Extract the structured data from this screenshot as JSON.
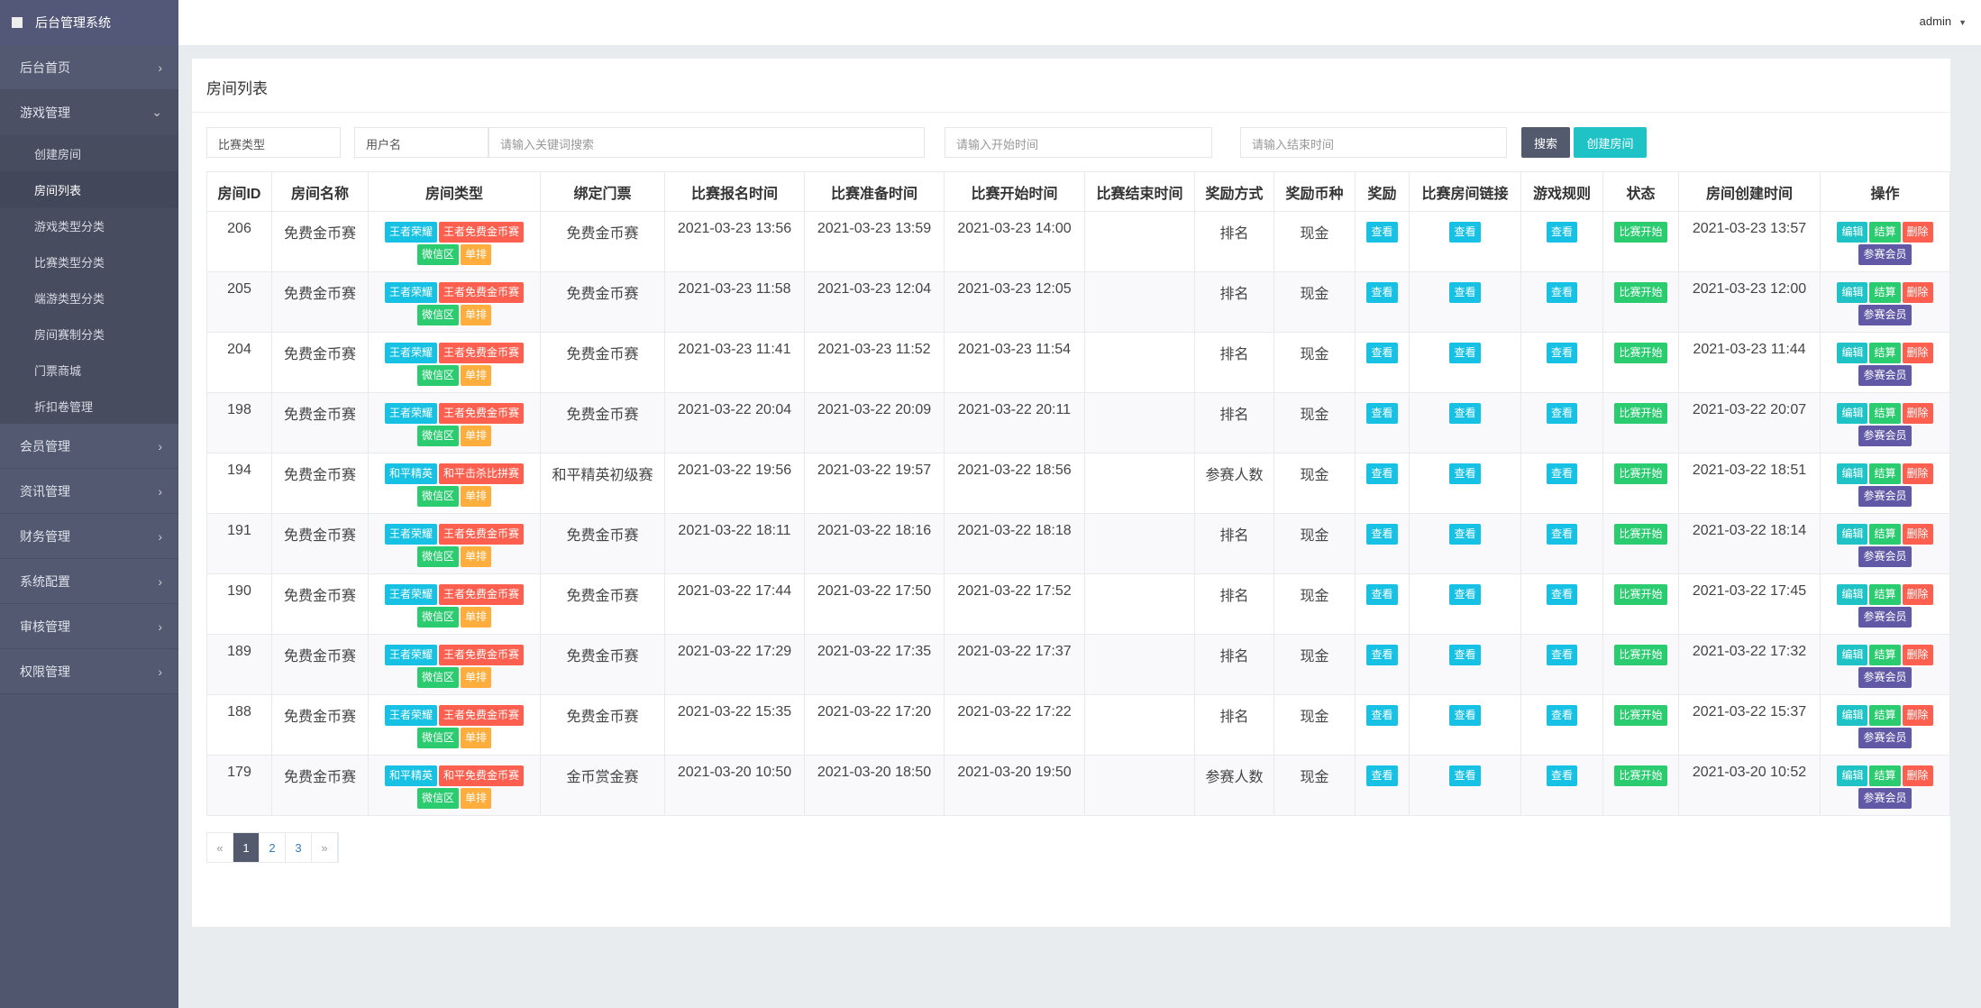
{
  "app_title": "后台管理系统",
  "user": {
    "name": "admin"
  },
  "sidebar": [
    {
      "label": "后台首页",
      "open": false
    },
    {
      "label": "游戏管理",
      "open": true,
      "children": [
        "创建房间",
        "房间列表",
        "游戏类型分类",
        "比赛类型分类",
        "端游类型分类",
        "房间赛制分类",
        "门票商城",
        "折扣卷管理"
      ],
      "active_child": 1
    },
    {
      "label": "会员管理"
    },
    {
      "label": "资讯管理"
    },
    {
      "label": "财务管理"
    },
    {
      "label": "系统配置"
    },
    {
      "label": "审核管理"
    },
    {
      "label": "权限管理"
    }
  ],
  "page_title": "房间列表",
  "filters": {
    "match_type": "比赛类型",
    "username": "用户名",
    "keyword_placeholder": "请输入关键词搜索",
    "start_placeholder": "请输入开始时间",
    "end_placeholder": "请输入结束时间",
    "search": "搜索",
    "create": "创建房间"
  },
  "colors": {
    "cyan": "#17c1e3",
    "red": "#ff5f4e",
    "green": "#2bcb70",
    "orange": "#ffad3c",
    "teal": "#1fc3c6",
    "purple": "#6159a6",
    "dark": "#535a6e"
  },
  "table": {
    "columns": [
      "房间ID",
      "房间名称",
      "房间类型",
      "绑定门票",
      "比赛报名时间",
      "比赛准备时间",
      "比赛开始时间",
      "比赛结束时间",
      "奖励方式",
      "奖励币种",
      "奖励",
      "比赛房间链接",
      "游戏规则",
      "状态",
      "房间创建时间",
      "操作"
    ],
    "view_label": "查看",
    "status_label": "比赛开始",
    "actions": [
      "编辑",
      "结算",
      "删除",
      "参赛会员"
    ],
    "rows": [
      {
        "id": "206",
        "name": "免费金币赛",
        "types": [
          "王者荣耀",
          "王者免费金币赛",
          "微信区",
          "单排"
        ],
        "ticket": "免费金币赛",
        "signup": "2021-03-23 13:56",
        "prepare": "2021-03-23 13:59",
        "start": "2021-03-23 14:00",
        "end": "",
        "reward_mode": "排名",
        "currency": "现金",
        "created": "2021-03-23 13:57"
      },
      {
        "id": "205",
        "name": "免费金币赛",
        "types": [
          "王者荣耀",
          "王者免费金币赛",
          "微信区",
          "单排"
        ],
        "ticket": "免费金币赛",
        "signup": "2021-03-23 11:58",
        "prepare": "2021-03-23 12:04",
        "start": "2021-03-23 12:05",
        "end": "",
        "reward_mode": "排名",
        "currency": "现金",
        "created": "2021-03-23 12:00"
      },
      {
        "id": "204",
        "name": "免费金币赛",
        "types": [
          "王者荣耀",
          "王者免费金币赛",
          "微信区",
          "单排"
        ],
        "ticket": "免费金币赛",
        "signup": "2021-03-23 11:41",
        "prepare": "2021-03-23 11:52",
        "start": "2021-03-23 11:54",
        "end": "",
        "reward_mode": "排名",
        "currency": "现金",
        "created": "2021-03-23 11:44"
      },
      {
        "id": "198",
        "name": "免费金币赛",
        "types": [
          "王者荣耀",
          "王者免费金币赛",
          "微信区",
          "单排"
        ],
        "ticket": "免费金币赛",
        "signup": "2021-03-22 20:04",
        "prepare": "2021-03-22 20:09",
        "start": "2021-03-22 20:11",
        "end": "",
        "reward_mode": "排名",
        "currency": "现金",
        "created": "2021-03-22 20:07"
      },
      {
        "id": "194",
        "name": "免费金币赛",
        "types": [
          "和平精英",
          "和平击杀比拼赛",
          "微信区",
          "单排"
        ],
        "ticket": "和平精英初级赛",
        "signup": "2021-03-22 19:56",
        "prepare": "2021-03-22 19:57",
        "start": "2021-03-22 18:56",
        "end": "",
        "reward_mode": "参赛人数",
        "currency": "现金",
        "created": "2021-03-22 18:51"
      },
      {
        "id": "191",
        "name": "免费金币赛",
        "types": [
          "王者荣耀",
          "王者免费金币赛",
          "微信区",
          "单排"
        ],
        "ticket": "免费金币赛",
        "signup": "2021-03-22 18:11",
        "prepare": "2021-03-22 18:16",
        "start": "2021-03-22 18:18",
        "end": "",
        "reward_mode": "排名",
        "currency": "现金",
        "created": "2021-03-22 18:14"
      },
      {
        "id": "190",
        "name": "免费金币赛",
        "types": [
          "王者荣耀",
          "王者免费金币赛",
          "微信区",
          "单排"
        ],
        "ticket": "免费金币赛",
        "signup": "2021-03-22 17:44",
        "prepare": "2021-03-22 17:50",
        "start": "2021-03-22 17:52",
        "end": "",
        "reward_mode": "排名",
        "currency": "现金",
        "created": "2021-03-22 17:45"
      },
      {
        "id": "189",
        "name": "免费金币赛",
        "types": [
          "王者荣耀",
          "王者免费金币赛",
          "微信区",
          "单排"
        ],
        "ticket": "免费金币赛",
        "signup": "2021-03-22 17:29",
        "prepare": "2021-03-22 17:35",
        "start": "2021-03-22 17:37",
        "end": "",
        "reward_mode": "排名",
        "currency": "现金",
        "created": "2021-03-22 17:32"
      },
      {
        "id": "188",
        "name": "免费金币赛",
        "types": [
          "王者荣耀",
          "王者免费金币赛",
          "微信区",
          "单排"
        ],
        "ticket": "免费金币赛",
        "signup": "2021-03-22 15:35",
        "prepare": "2021-03-22 17:20",
        "start": "2021-03-22 17:22",
        "end": "",
        "reward_mode": "排名",
        "currency": "现金",
        "created": "2021-03-22 15:37"
      },
      {
        "id": "179",
        "name": "免费金币赛",
        "types": [
          "和平精英",
          "和平免费金币赛",
          "微信区",
          "单排"
        ],
        "ticket": "金币赏金赛",
        "signup": "2021-03-20 10:50",
        "prepare": "2021-03-20 18:50",
        "start": "2021-03-20 19:50",
        "end": "",
        "reward_mode": "参赛人数",
        "currency": "现金",
        "created": "2021-03-20 10:52"
      }
    ]
  },
  "pagination": {
    "prev": "«",
    "pages": [
      "1",
      "2",
      "3"
    ],
    "current": "1",
    "next": "»"
  }
}
